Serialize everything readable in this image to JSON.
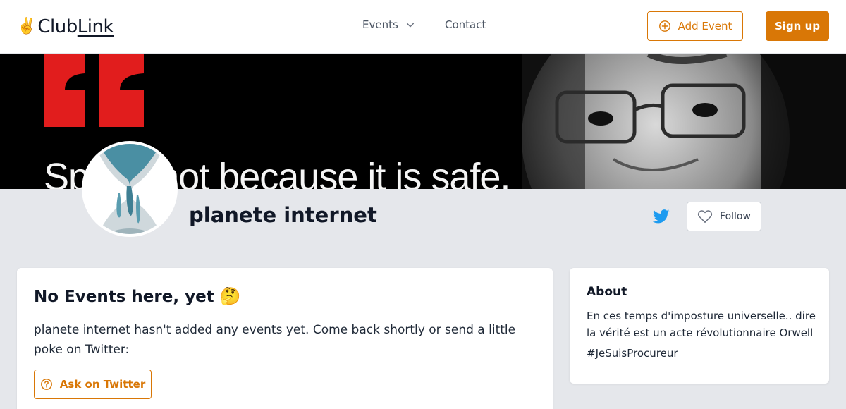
{
  "header": {
    "logo_emoji": "✌️",
    "logo_part1": "Club",
    "logo_part2": "Link",
    "nav": {
      "events_label": "Events",
      "contact_label": "Contact"
    },
    "add_event_label": "Add Event",
    "signup_label": "Sign up"
  },
  "banner": {
    "quote_text": "Speak not because it is safe,"
  },
  "profile": {
    "name": "planete internet",
    "follow_label": "Follow"
  },
  "events_card": {
    "title": "No Events here, yet",
    "emoji": "🤔",
    "description": "planete internet hasn't added any events yet. Come back shortly or send a little poke on Twitter:",
    "ask_button_label": "Ask on Twitter"
  },
  "about_card": {
    "title": "About",
    "text": "En ces temps d'imposture universelle.. dire la vérité est un acte révolutionnaire Orwell",
    "hashtag": "#JeSuisProcureur"
  },
  "colors": {
    "accent": "#d97706",
    "page_background": "#e5e7eb",
    "twitter_blue": "#1d9bf0"
  },
  "icons": {
    "events_chevron": "chevron-down-icon",
    "add_event": "plus-circle-icon",
    "twitter": "twitter-icon",
    "follow": "heart-icon",
    "ask": "question-circle-icon"
  }
}
